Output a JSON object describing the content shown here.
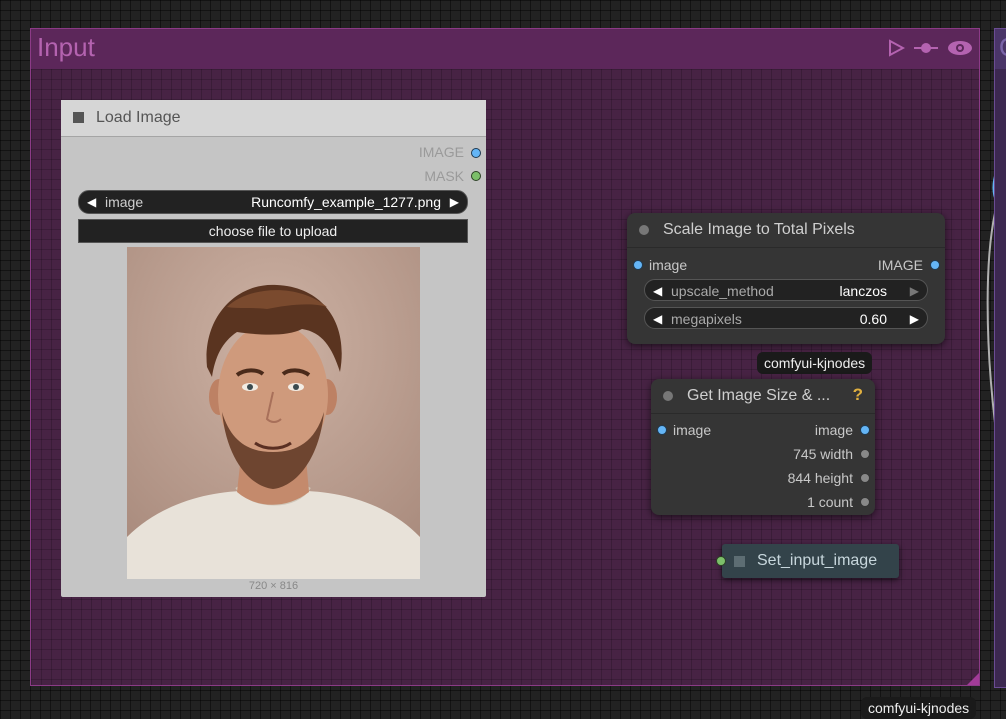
{
  "group": {
    "title": "Input"
  },
  "group2": {
    "title": "O"
  },
  "load_image": {
    "title": "Load Image",
    "outputs": [
      "IMAGE",
      "MASK"
    ],
    "image_widget": {
      "label": "image",
      "value": "Runcomfy_example_1277.png"
    },
    "upload_label": "choose file to upload",
    "dimensions": "720 × 816"
  },
  "scale_node": {
    "title": "Scale Image to Total Pixels",
    "input": "image",
    "output": "IMAGE",
    "widgets": [
      {
        "label": "upscale_method",
        "value": "lanczos"
      },
      {
        "label": "megapixels",
        "value": "0.60"
      }
    ]
  },
  "badge1": "comfyui-kjnodes",
  "badge2": "comfyui-kjnodes",
  "size_node": {
    "title": "Get Image Size & ...",
    "help": "?",
    "input": "image",
    "outputs": [
      "image",
      "745 width",
      "844 height",
      "1 count"
    ]
  },
  "set_node": {
    "title": "Set_input_image"
  },
  "colors": {
    "group_bg": "#472344",
    "group_header": "#5c275a",
    "group_title": "#b463b0",
    "image_link": "#64b5f6",
    "mask_port": "#7cbf6a",
    "set_node_bg": "#33434a"
  }
}
